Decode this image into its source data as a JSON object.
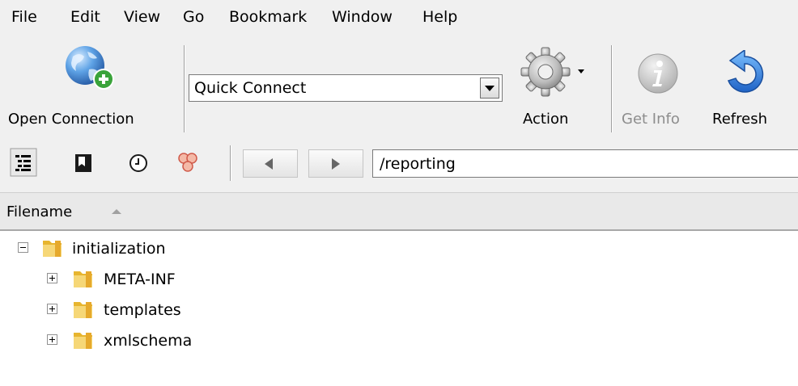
{
  "menu": [
    "File",
    "Edit",
    "View",
    "Go",
    "Bookmark",
    "Window",
    "Help"
  ],
  "toolbar": {
    "open_connection_label": "Open Connection",
    "quick_connect_value": "Quick Connect",
    "action_label": "Action",
    "get_info_label": "Get Info",
    "refresh_label": "Refresh"
  },
  "navbar": {
    "path": "/reporting"
  },
  "columns": {
    "filename_label": "Filename"
  },
  "tree": {
    "root": "initialization",
    "children": [
      "META-INF",
      "templates",
      "xmlschema"
    ]
  },
  "colors": {
    "accent_blue": "#2f7fd3",
    "folder_yellow": "#f3c94a",
    "disabled_text": "#8d8d8d"
  }
}
